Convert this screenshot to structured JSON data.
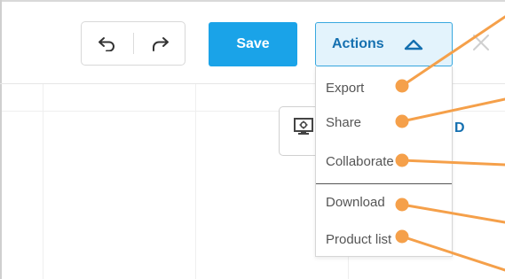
{
  "toolbar": {
    "save_label": "Save",
    "actions_label": "Actions"
  },
  "actions_menu": {
    "items": [
      {
        "label": "Export"
      },
      {
        "label": "Share"
      },
      {
        "label": "Collaborate"
      },
      {
        "label": "Download"
      },
      {
        "label": "Product list"
      }
    ]
  },
  "canvas": {
    "partial_label": "D"
  },
  "icons": {
    "undo": "undo-icon",
    "redo": "redo-icon",
    "caret": "chevron-up-icon",
    "close": "close-icon",
    "device": "screen-settings-icon"
  },
  "colors": {
    "save_bg": "#1aa3e8",
    "actions_bg": "#e3f3fc",
    "actions_border": "#38a8df",
    "actions_text": "#1570b0",
    "annotation": "#f5a04a"
  }
}
